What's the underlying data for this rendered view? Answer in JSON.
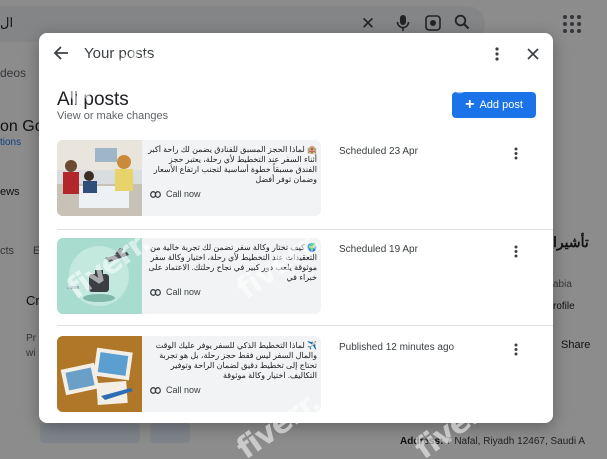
{
  "background": {
    "search_fragment": "ال",
    "left_tab_fragment": "deos",
    "left_heading_fragment": "on Go",
    "left_link_fragment": "tions",
    "left_news_fragment": "ews",
    "left_tab2_fragment": "cts",
    "left_tab3_fragment": "E",
    "left_card_fragment": "Cr",
    "left_card_sub1": "Pr",
    "left_card_sub2": "wi",
    "right_heading_fragment": "تأشيرا",
    "right_sub_fragment": "abia",
    "right_profile_fragment": "rofile",
    "right_share_fragment": "Share",
    "address_label": "Address:",
    "address_value": "7 Nafal, Riyadh 12467, Saudi A"
  },
  "dialog": {
    "title": "Your posts",
    "section_title": "All posts",
    "section_subtitle": "View or make changes",
    "add_post_label": "Add post"
  },
  "posts": [
    {
      "text": "🏨 لماذا الحجز المسبق للفنادق يضمن لك راحة أكبر أثناء السفر عند التخطيط لأي رحلة، يعتبر حجز الفندق مسبقاً خطوة أساسية لتجنب ارتفاع الأسعار وضمان توفر أفضل",
      "cta": "Call now",
      "status": "Scheduled 23 Apr"
    },
    {
      "text": "🌍 كيف تختار وكالة سفر تضمن لك تجربة خالية من التعقيدات عند التخطيط لأي رحلة، اختيار وكالة سفر موثوقة يلعب دور كبير في نجاح رحلتك. الاعتماد على خبراء في",
      "cta": "Call now",
      "status": "Scheduled 19 Apr"
    },
    {
      "text": "✈️ لماذا التخطيط الذكي للسفر يوفر عليك الوقت والمال السفر ليس فقط حجز رحلة، بل هو تجربة تحتاج إلى تخطيط دقيق لضمان الراحة وتوفير التكاليف. اختيار وكالة موثوقة",
      "cta": "Call now",
      "status": "Published 12 minutes ago"
    }
  ],
  "watermark": "fiverr."
}
